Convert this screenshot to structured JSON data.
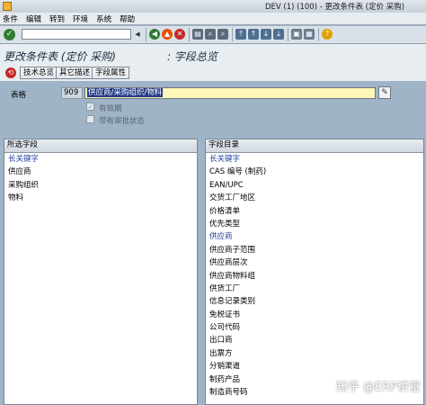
{
  "window": {
    "title": "DEV (1) (100) - 更改条件表 (定价 采购)"
  },
  "menu": [
    "条件",
    "编辑",
    "转到",
    "环境",
    "系统",
    "帮助"
  ],
  "toolbar": {
    "icons": [
      "ok-check-icon",
      "command-field",
      "back-icon",
      "exit-icon",
      "cancel-icon",
      "print-icon",
      "find-icon",
      "find-next-icon",
      "first-page-icon",
      "prev-page-icon",
      "next-page-icon",
      "last-page-icon",
      "create-session-icon",
      "shortcut-icon",
      "help-icon"
    ]
  },
  "header": {
    "title": "更改条件表 (定价 采购)",
    "subtitle": ": 字段总览",
    "buttons": [
      "技术总览",
      "其它描述",
      "字段属性"
    ]
  },
  "form": {
    "table_label": "表格",
    "table_number": "909",
    "table_desc": "供应商/采购组织/物料",
    "checkbox1_label": "有效期",
    "checkbox2_label": "带有审批状态"
  },
  "selected_fields": {
    "title": "所选字段",
    "header_row": "长关键字",
    "rows": [
      "供应商",
      "采购组织",
      "物料"
    ]
  },
  "field_catalog": {
    "title": "字段目录",
    "header_row": "长关键字",
    "rows": [
      "CAS 编号 (制药)",
      "EAN/UPC",
      "交货工厂地区",
      "价格清单",
      "优先类型",
      "供应商",
      "供应商子范围",
      "供应商层次",
      "供应商物料组",
      "供货工厂",
      "信息记录类别",
      "免税证书",
      "公司代码",
      "出口商",
      "出票方",
      "分销渠道",
      "制药产品",
      "制造商号码"
    ],
    "highlight_row": "供应商"
  },
  "watermark": "知乎 @ERP讲堂",
  "colors": {
    "bg": "#9fb4c6",
    "input_yellow": "#fff7b8",
    "selection": "#223b88",
    "header_text": "#1f3e9e"
  }
}
